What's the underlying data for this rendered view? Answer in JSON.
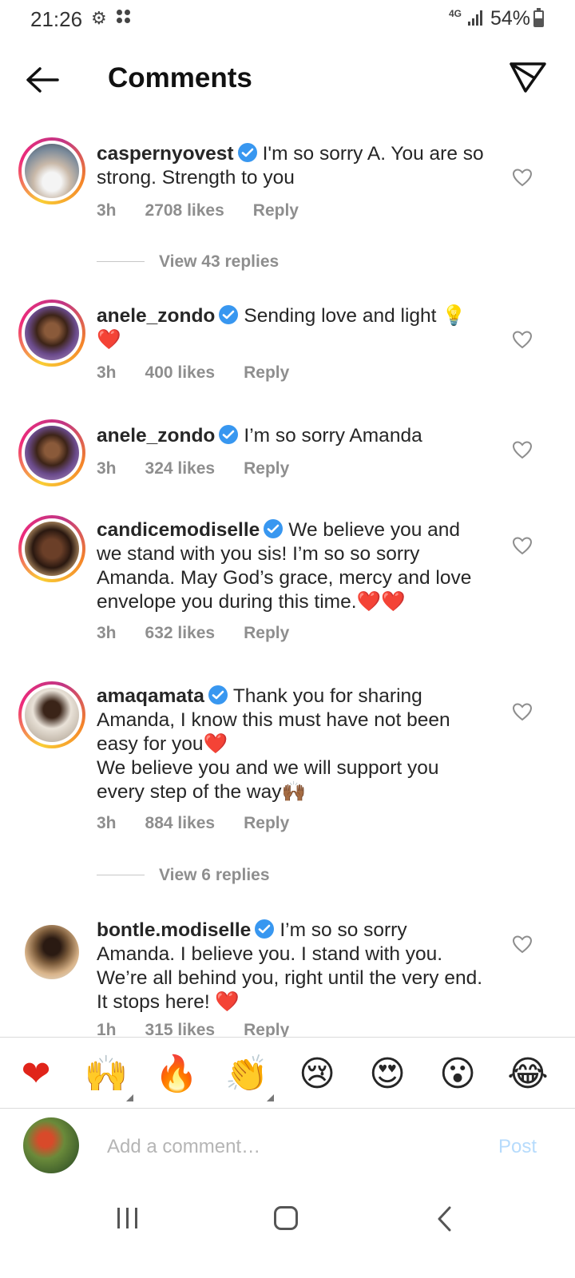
{
  "status_bar": {
    "time": "21:26",
    "network": "4G",
    "battery": "54%",
    "battery_level": 0.54,
    "icons": [
      "gear-icon",
      "dots-icon",
      "signal-icon",
      "battery-icon"
    ]
  },
  "header": {
    "title": "Comments",
    "back_icon": "arrow-left-icon",
    "share_icon": "paper-plane-icon"
  },
  "comments": [
    {
      "username": "caspernyovest",
      "verified": true,
      "text": "I'm so sorry A. You are so strong.  Strength to you",
      "time": "3h",
      "likes": "2708 likes",
      "reply": "Reply",
      "view_replies": "View 43 replies"
    },
    {
      "username": "anele_zondo",
      "verified": true,
      "text": "Sending love and light 💡 ❤️",
      "time": "3h",
      "likes": "400 likes",
      "reply": "Reply"
    },
    {
      "username": "anele_zondo",
      "verified": true,
      "text": "I’m so sorry Amanda",
      "time": "3h",
      "likes": "324 likes",
      "reply": "Reply"
    },
    {
      "username": "candicemodiselle",
      "verified": true,
      "text": "We believe you and we stand with you sis! I’m so so sorry Amanda. May God’s grace, mercy and love envelope you during this time.❤️❤️",
      "time": "3h",
      "likes": "632 likes",
      "reply": "Reply"
    },
    {
      "username": "amaqamata",
      "verified": true,
      "text": "Thank you for sharing Amanda, I know this must have not been easy for you❤️",
      "text2": "We believe you and we will support you every step of the way🙌🏾",
      "time": "3h",
      "likes": "884 likes",
      "reply": "Reply",
      "view_replies": "View 6 replies"
    },
    {
      "username": "bontle.modiselle",
      "verified": true,
      "text": "I’m so so sorry Amanda. I believe you. I stand with you. We’re all behind you, right until the very end. It stops here! ❤️",
      "time": "1h",
      "likes": "315 likes",
      "reply": "Reply"
    }
  ],
  "reactions": [
    "❤",
    "🙌",
    "🔥",
    "👏",
    "😢",
    "😍",
    "😮",
    "😂"
  ],
  "reaction_names": [
    "heart-emoji",
    "raised-hands-emoji",
    "fire-emoji",
    "clapping-emoji",
    "crying-emoji",
    "heart-eyes-emoji",
    "surprised-emoji",
    "laughing-emoji"
  ],
  "input": {
    "placeholder": "Add a comment…",
    "post_label": "Post"
  },
  "colors": {
    "text": "#262626",
    "secondary": "#8e8e8e",
    "verified": "#3897f0",
    "post_disabled": "#b6dbfc",
    "heart": "#e0241a"
  }
}
